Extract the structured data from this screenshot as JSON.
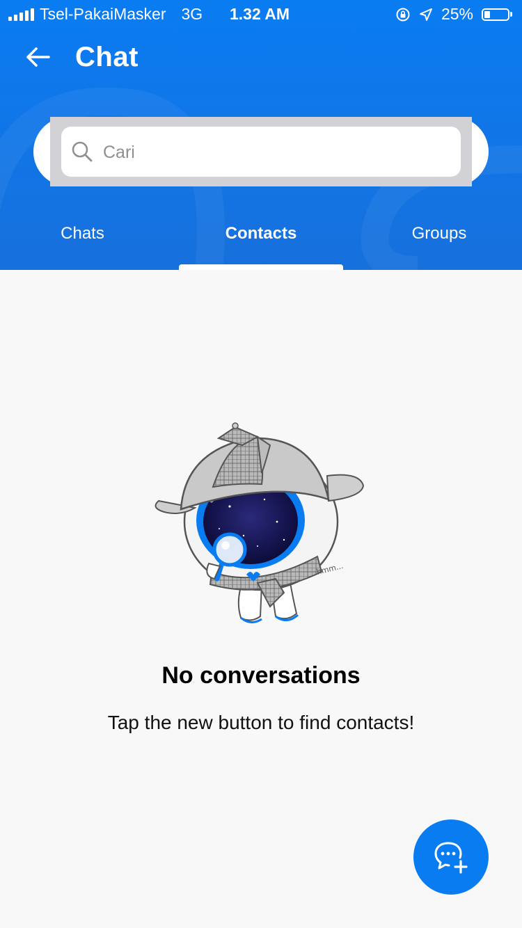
{
  "status_bar": {
    "carrier": "Tsel-PakaiMasker",
    "network": "3G",
    "time": "1.32 AM",
    "battery": "25%",
    "battery_level": 0.25
  },
  "header": {
    "title": "Chat",
    "back_icon": "arrow-left-icon"
  },
  "search": {
    "placeholder": "Cari",
    "value": ""
  },
  "tabs": [
    {
      "label": "Chats",
      "active": false
    },
    {
      "label": "Contacts",
      "active": true
    },
    {
      "label": "Groups",
      "active": false
    }
  ],
  "empty_state": {
    "title": "No conversations",
    "subtitle": "Tap the new button to find contacts!",
    "illustration_caption": "hmm..."
  },
  "fab": {
    "icon": "new-chat-icon"
  },
  "colors": {
    "primary": "#0a7cf2",
    "background": "#f8f8f8",
    "search_track": "#d2d1d6"
  }
}
